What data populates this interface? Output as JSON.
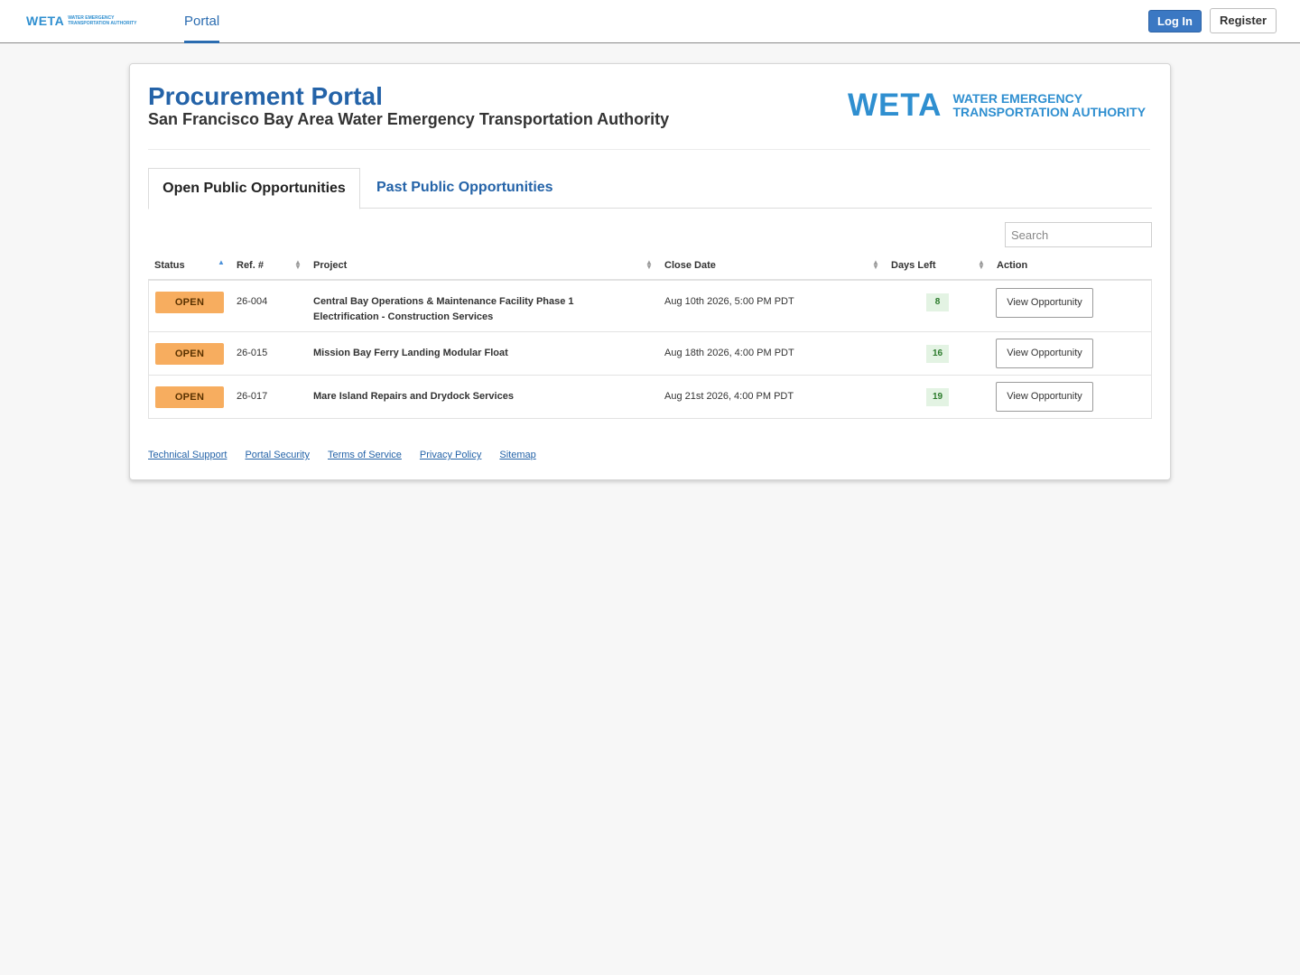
{
  "nav": {
    "logo_text": "WETA",
    "logo_sub": "Water Emergency Transportation Authority",
    "portal": "Portal",
    "login": "Log In",
    "register": "Register"
  },
  "header": {
    "title": "Procurement Portal",
    "subtitle": "San Francisco Bay Area Water Emergency Transportation Authority",
    "logo_text": "WETA",
    "logo_sub_line1": "Water Emergency",
    "logo_sub_line2": "Transportation Authority"
  },
  "tabs": {
    "open": "Open Public Opportunities",
    "past": "Past Public Opportunities"
  },
  "search": {
    "placeholder": "Search"
  },
  "table": {
    "columns": [
      "Status",
      "Ref. #",
      "Project",
      "Close Date",
      "Days Left",
      "Action"
    ],
    "rows": [
      {
        "status": "OPEN",
        "ref": "26-004",
        "project": "Central Bay Operations & Maintenance Facility Phase 1 Electrification - Construction Services",
        "close_date": "Aug 10th 2026, 5:00 PM PDT",
        "days_left": "8",
        "action": "View Opportunity"
      },
      {
        "status": "OPEN",
        "ref": "26-015",
        "project": "Mission Bay Ferry Landing Modular Float",
        "close_date": "Aug 18th 2026, 4:00 PM PDT",
        "days_left": "16",
        "action": "View Opportunity"
      },
      {
        "status": "OPEN",
        "ref": "26-017",
        "project": "Mare Island Repairs and Drydock Services",
        "close_date": "Aug 21st 2026, 4:00 PM PDT",
        "days_left": "19",
        "action": "View Opportunity"
      }
    ]
  },
  "footer": {
    "links": [
      "Technical Support",
      "Portal Security",
      "Terms of Service",
      "Privacy Policy",
      "Sitemap"
    ]
  },
  "colors": {
    "brand_blue": "#2463a8",
    "logo_blue": "#2f8fd0",
    "open_badge": "#f7ad5f",
    "days_badge": "#e3f3e3"
  }
}
